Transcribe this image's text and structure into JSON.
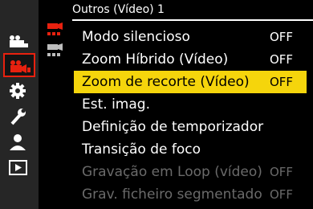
{
  "colors": {
    "accent_red": "#e8210f",
    "highlight_yellow": "#f5d50c",
    "sidebar_bg": "#262626",
    "disabled_text": "#6a6a6a"
  },
  "title": "Outros (Vídeo) 1",
  "sidebar": {
    "items": [
      {
        "icon": "photo-camera-icon",
        "active": false
      },
      {
        "icon": "video-camera-icon",
        "active": true
      },
      {
        "icon": "gear-icon",
        "active": false
      },
      {
        "icon": "wrench-icon",
        "active": false
      },
      {
        "icon": "person-icon",
        "active": false
      },
      {
        "icon": "playback-icon",
        "active": false
      }
    ]
  },
  "subtabs": [
    {
      "icon": "video-menu-page-icon",
      "active": true
    },
    {
      "icon": "video-menu-page-icon",
      "active": false
    }
  ],
  "menu": {
    "items": [
      {
        "label": "Modo silencioso",
        "value": "OFF",
        "state": "normal"
      },
      {
        "label": "Zoom Híbrido (Vídeo)",
        "value": "OFF",
        "state": "normal"
      },
      {
        "label": "Zoom de recorte (Vídeo)",
        "value": "OFF",
        "state": "selected"
      },
      {
        "label": "Est. imag.",
        "value": "",
        "state": "normal"
      },
      {
        "label": "Definição de temporizador",
        "value": "",
        "state": "normal"
      },
      {
        "label": "Transição de foco",
        "value": "",
        "state": "normal"
      },
      {
        "label": "Gravação em Loop (vídeo)",
        "value": "OFF",
        "state": "disabled"
      },
      {
        "label": "Grav. ficheiro segmentado",
        "value": "OFF",
        "state": "disabled"
      }
    ]
  }
}
